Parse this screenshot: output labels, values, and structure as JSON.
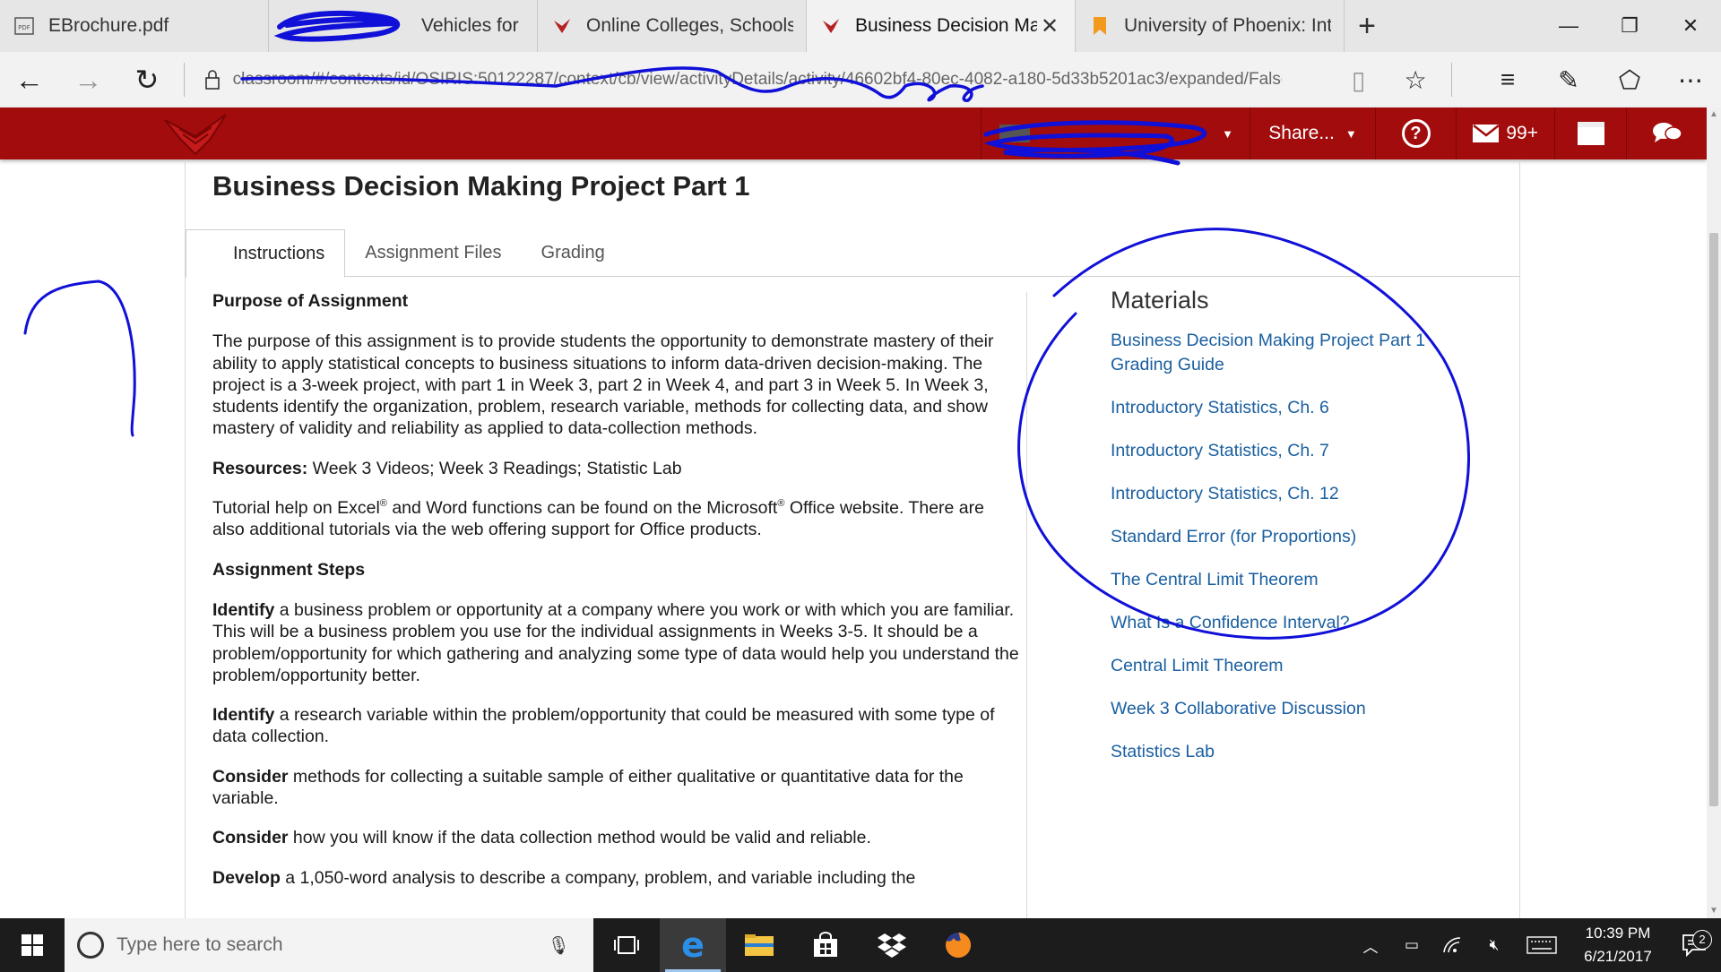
{
  "browser": {
    "tabs": [
      {
        "label": "EBrochure.pdf",
        "icon": "pdf-icon",
        "active": false
      },
      {
        "label": "Vehicles for Sale",
        "icon": "car-icon",
        "active": false
      },
      {
        "label": "Online Colleges, Schools &",
        "icon": "phoenix-icon",
        "active": false
      },
      {
        "label": "Business Decision Makin",
        "icon": "phoenix-icon",
        "active": true
      },
      {
        "label": "University of Phoenix: Introd",
        "icon": "bookmark-icon",
        "active": false
      }
    ],
    "new_tab_label": "+",
    "url": "classroom/#/contexts/id/OSIRIS:50122287/context/cb/view/activityDetails/activity/46602bf4-80ec-4082-a180-5d33b5201ac3/expanded/False"
  },
  "site_header": {
    "user_name": "",
    "share_label": "Share...",
    "help_label": "?",
    "messages_count": "99+"
  },
  "page": {
    "title": "Business Decision Making Project Part 1",
    "tabs": [
      "Instructions",
      "Assignment Files",
      "Grading"
    ],
    "active_tab": "Instructions"
  },
  "instructions": {
    "purpose_heading": "Purpose of Assignment",
    "purpose_text": "The purpose of this assignment is to provide students the opportunity to demonstrate mastery of their ability to apply statistical concepts to business situations to inform data-driven decision-making. The project is a 3-week project, with part 1 in Week 3, part 2 in Week 4, and part 3 in Week 5. In Week 3, students identify the organization, problem, research variable, methods for collecting data, and show mastery of validity and reliability as applied to data-collection methods.",
    "resources_label": "Resources:",
    "resources_text": " Week 3 Videos; Week 3 Readings; Statistic Lab",
    "tutorial_part1": "Tutorial help on Excel",
    "tutorial_part2": " and Word functions can be found on the Microsoft",
    "tutorial_part3": " Office website. There are also additional tutorials via the web offering support for Office products.",
    "registered_mark": "®",
    "steps_heading": "Assignment Steps",
    "steps": [
      {
        "lead": "Identify",
        "text": " a business problem or opportunity at a company where you work or with which you are familiar. This will be a business problem you use for the individual assignments in Weeks 3-5. It should be a problem/opportunity for which gathering and analyzing some type of data would help you understand the problem/opportunity better."
      },
      {
        "lead": "Identify",
        "text": " a research variable within the problem/opportunity that could be measured with some type of data collection."
      },
      {
        "lead": "Consider",
        "text": " methods for collecting a suitable sample of either qualitative or quantitative data for the variable."
      },
      {
        "lead": "Consider",
        "text": " how you will know if the data collection method would be valid and reliable."
      },
      {
        "lead": "Develop",
        "text": " a 1,050-word analysis to describe a company, problem, and variable including the"
      }
    ]
  },
  "materials": {
    "title": "Materials",
    "links": [
      "Business Decision Making Project Part 1 Grading Guide",
      "Introductory Statistics, Ch. 6",
      "Introductory Statistics, Ch. 7",
      "Introductory Statistics, Ch. 12",
      "Standard Error (for Proportions)",
      "The Central Limit Theorem",
      "What Is a Confidence Interval?",
      "Central Limit Theorem",
      "Week 3 Collaborative Discussion",
      "Statistics Lab"
    ]
  },
  "taskbar": {
    "search_placeholder": "Type here to search",
    "time": "10:39 PM",
    "date": "6/21/2017",
    "notification_count": "2"
  },
  "colors": {
    "header_red": "#a20c0c",
    "link_blue": "#1a5fa0",
    "ink_blue": "#1010d8",
    "taskbar": "#1c1c1c"
  }
}
